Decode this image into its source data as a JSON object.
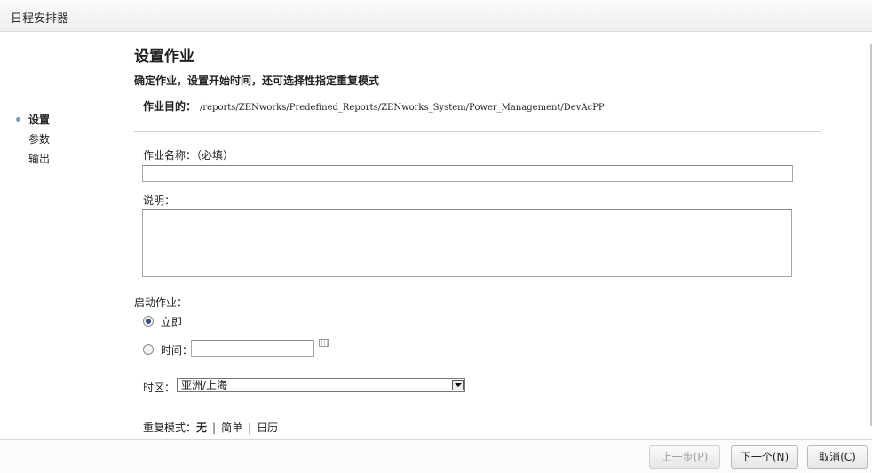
{
  "window": {
    "title": "日程安排器"
  },
  "nav": {
    "items": [
      "设置",
      "参数",
      "输出"
    ],
    "active": "设置"
  },
  "page": {
    "heading": "设置作业",
    "subtitle": "确定作业，设置开始时间，还可选择性指定重复模式",
    "purpose_label": "作业目的：",
    "purpose_value": "/reports/ZENworks/Predefined_Reports/ZENworks_System/Power_Management/DevAcPP"
  },
  "form": {
    "name_label": "作业名称：（必填）",
    "name_value": "",
    "desc_label": "说明：",
    "desc_value": "",
    "start_label": "启动作业：",
    "start_now_label": "立即",
    "start_time_label": "时间：",
    "start_time_value": "",
    "start_selected": "立即",
    "timezone_label": "时区：",
    "timezone_value": "亚洲/上海",
    "repeat_label": "重复模式：",
    "repeat_options": [
      "无",
      "简单",
      "日历"
    ],
    "repeat_selected": "无"
  },
  "footer": {
    "prev_label": "上一步(P)",
    "next_label": "下一个(N)",
    "cancel_label": "取消(C)"
  }
}
